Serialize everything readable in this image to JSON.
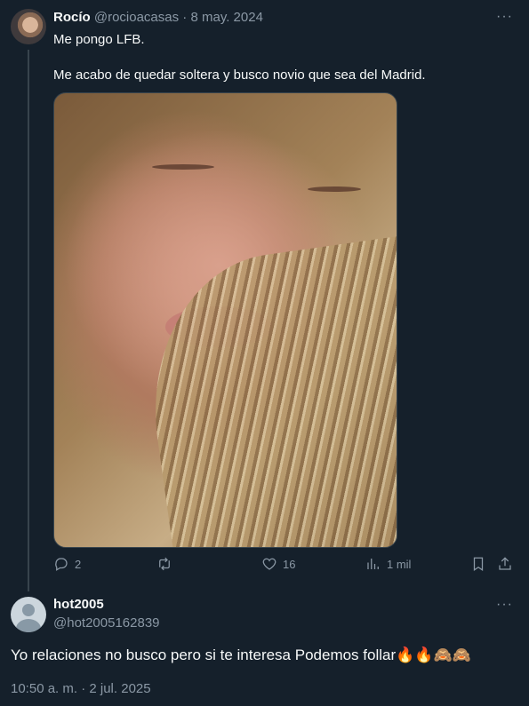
{
  "tweet": {
    "author_name": "Rocío",
    "author_handle": "@rocioacasas",
    "separator": "·",
    "date": "8 may. 2024",
    "more_label": "···",
    "text_line1": "Me pongo LFB.",
    "text_line2": "Me acabo de quedar soltera y busco novio que sea del Madrid.",
    "media_icon": "photo-of-woman",
    "stats": {
      "replies": "2",
      "retweets": "",
      "likes": "16",
      "views": "1 mil"
    }
  },
  "reply": {
    "author_name": "hot2005",
    "author_handle": "@hot2005162839",
    "more_label": "···",
    "text": "Yo relaciones no busco pero si te interesa Podemos follar🔥🔥🙈🙈",
    "timestamp": "10:50 a. m. · 2 jul. 2025"
  },
  "colors": {
    "background": "#15202b",
    "text": "#f7f9f9",
    "muted": "#8b98a5",
    "border": "#38444d"
  }
}
